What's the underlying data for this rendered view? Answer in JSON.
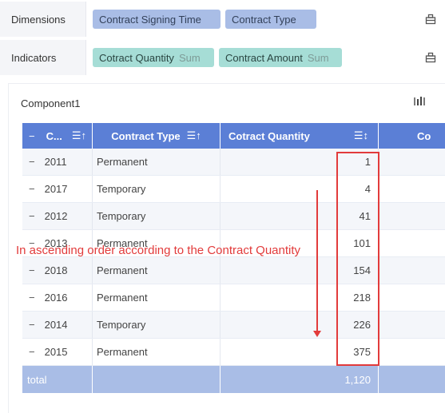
{
  "dimensions": {
    "label": "Dimensions",
    "fields": [
      "Contract Signing Time",
      "Contract Type"
    ]
  },
  "indicators": {
    "label": "Indicators",
    "fields": [
      {
        "name": "Cotract Quantity",
        "agg": "Sum"
      },
      {
        "name": "Contract Amount",
        "agg": "Sum"
      }
    ]
  },
  "component": {
    "title": "Component1"
  },
  "table": {
    "headers": [
      "C...",
      "Contract Type",
      "Cotract Quantity",
      "Co"
    ],
    "rows": [
      {
        "year": "2011",
        "type": "Permanent",
        "qty": "1"
      },
      {
        "year": "2017",
        "type": "Temporary",
        "qty": "4"
      },
      {
        "year": "2012",
        "type": "Temporary",
        "qty": "41"
      },
      {
        "year": "2013",
        "type": "Permanent",
        "qty": "101"
      },
      {
        "year": "2018",
        "type": "Permanent",
        "qty": "154"
      },
      {
        "year": "2016",
        "type": "Permanent",
        "qty": "218"
      },
      {
        "year": "2014",
        "type": "Temporary",
        "qty": "226"
      },
      {
        "year": "2015",
        "type": "Permanent",
        "qty": "375"
      }
    ],
    "total_label": "total",
    "total_qty": "1,120"
  },
  "annotation": "In ascending order according to the Contract Quantity",
  "colors": {
    "header": "#5b7fd6",
    "dimension_pill": "#a9bde6",
    "indicator_pill": "#a6ddd6",
    "annotation": "#e23b3b"
  }
}
